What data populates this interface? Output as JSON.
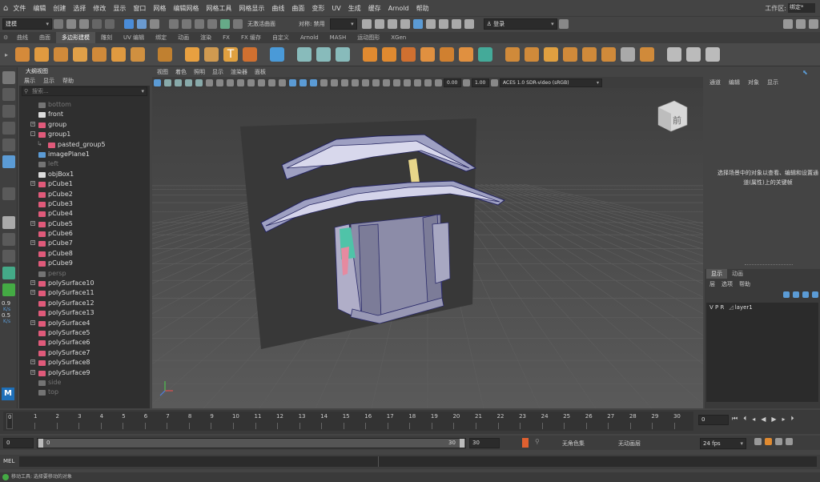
{
  "menubar": {
    "items": [
      "文件",
      "编辑",
      "创建",
      "选择",
      "修改",
      "显示",
      "窗口",
      "网格",
      "编辑网格",
      "网格工具",
      "网格显示",
      "曲线",
      "曲面",
      "变形",
      "UV",
      "生成",
      "缓存",
      "Arnold",
      "帮助"
    ],
    "workspace_label": "工作区:",
    "workspace_value": "绑定*"
  },
  "statusline": {
    "mode": "建模",
    "live_surface": "无激活曲面",
    "symmetry": "对称: 禁用",
    "login": "登录"
  },
  "shelf": {
    "tabs": [
      "曲线",
      "曲面",
      "多边形建模",
      "雕刻",
      "UV 编辑",
      "绑定",
      "动画",
      "渲染",
      "FX",
      "FX 缓存",
      "自定义",
      "Arnold",
      "MASH",
      "运动图形",
      "XGen"
    ],
    "active_tab": "多边形建模"
  },
  "outliner": {
    "title": "大纲视图",
    "menu": [
      "展示",
      "显示",
      "帮助"
    ],
    "search_placeholder": "搜索...",
    "items": [
      {
        "label": "bottom",
        "indent": 1,
        "expand": "",
        "icon": "camera-icon",
        "dim": true
      },
      {
        "label": "front",
        "indent": 1,
        "expand": "",
        "icon": "camera-icon",
        "dim": false
      },
      {
        "label": "group",
        "indent": 1,
        "expand": "+",
        "icon": "group-icon",
        "dim": false
      },
      {
        "label": "group1",
        "indent": 1,
        "expand": "-",
        "icon": "group-icon",
        "dim": false
      },
      {
        "label": "pasted_group5",
        "indent": 2,
        "expand": "",
        "icon": "group-icon",
        "dim": false
      },
      {
        "label": "imagePlane1",
        "indent": 1,
        "expand": "",
        "icon": "image-plane-icon",
        "dim": false
      },
      {
        "label": "left",
        "indent": 1,
        "expand": "",
        "icon": "camera-icon",
        "dim": true
      },
      {
        "label": "objBox1",
        "indent": 1,
        "expand": "",
        "icon": "object-icon",
        "dim": false
      },
      {
        "label": "pCube1",
        "indent": 1,
        "expand": "+",
        "icon": "mesh-icon",
        "dim": false
      },
      {
        "label": "pCube2",
        "indent": 1,
        "expand": "",
        "icon": "mesh-icon",
        "dim": false
      },
      {
        "label": "pCube3",
        "indent": 1,
        "expand": "",
        "icon": "mesh-icon",
        "dim": false
      },
      {
        "label": "pCube4",
        "indent": 1,
        "expand": "",
        "icon": "mesh-icon",
        "dim": false
      },
      {
        "label": "pCube5",
        "indent": 1,
        "expand": "+",
        "icon": "mesh-icon",
        "dim": false
      },
      {
        "label": "pCube6",
        "indent": 1,
        "expand": "",
        "icon": "mesh-icon",
        "dim": false
      },
      {
        "label": "pCube7",
        "indent": 1,
        "expand": "+",
        "icon": "mesh-icon",
        "dim": false
      },
      {
        "label": "pCube8",
        "indent": 1,
        "expand": "",
        "icon": "mesh-icon",
        "dim": false
      },
      {
        "label": "pCube9",
        "indent": 1,
        "expand": "",
        "icon": "mesh-icon",
        "dim": false
      },
      {
        "label": "persp",
        "indent": 1,
        "expand": "",
        "icon": "camera-icon",
        "dim": true
      },
      {
        "label": "polySurface10",
        "indent": 1,
        "expand": "+",
        "icon": "mesh-icon",
        "dim": false
      },
      {
        "label": "polySurface11",
        "indent": 1,
        "expand": "+",
        "icon": "mesh-icon",
        "dim": false
      },
      {
        "label": "polySurface12",
        "indent": 1,
        "expand": "",
        "icon": "mesh-icon",
        "dim": false
      },
      {
        "label": "polySurface13",
        "indent": 1,
        "expand": "",
        "icon": "mesh-icon",
        "dim": false
      },
      {
        "label": "polySurface4",
        "indent": 1,
        "expand": "+",
        "icon": "mesh-icon",
        "dim": false
      },
      {
        "label": "polySurface5",
        "indent": 1,
        "expand": "",
        "icon": "mesh-icon",
        "dim": false
      },
      {
        "label": "polySurface6",
        "indent": 1,
        "expand": "",
        "icon": "mesh-icon",
        "dim": false
      },
      {
        "label": "polySurface7",
        "indent": 1,
        "expand": "",
        "icon": "mesh-icon",
        "dim": false
      },
      {
        "label": "polySurface8",
        "indent": 1,
        "expand": "+",
        "icon": "mesh-icon",
        "dim": false
      },
      {
        "label": "polySurface9",
        "indent": 1,
        "expand": "+",
        "icon": "mesh-icon",
        "dim": false
      },
      {
        "label": "side",
        "indent": 1,
        "expand": "",
        "icon": "camera-icon",
        "dim": true
      },
      {
        "label": "top",
        "indent": 1,
        "expand": "",
        "icon": "camera-icon",
        "dim": true
      }
    ]
  },
  "viewport": {
    "menu": [
      "视图",
      "着色",
      "照明",
      "显示",
      "渲染器",
      "面板"
    ],
    "field_a": "0.00",
    "field_b": "1.00",
    "colorspace": "ACES 1.0 SDR-video (sRGB)",
    "viewcube_label": "前"
  },
  "toolbox": {
    "value_1": "0.9",
    "unit_1": "K/s",
    "value_2": "0.5",
    "unit_2": "K/s"
  },
  "channelbox": {
    "menu": [
      "通道",
      "编辑",
      "对象",
      "显示"
    ],
    "message": "选择场景中的对象以查看、编辑和设置通道(属性)上的关键帧"
  },
  "layereditor": {
    "tabs": [
      "显示",
      "动画"
    ],
    "menu": [
      "层",
      "选项",
      "帮助"
    ],
    "layer_flags": "V P R",
    "layer_name": "layer1"
  },
  "timeslider": {
    "ticks": [
      "1",
      "2",
      "3",
      "4",
      "5",
      "6",
      "7",
      "8",
      "9",
      "10",
      "11",
      "12",
      "13",
      "14",
      "15",
      "16",
      "17",
      "18",
      "19",
      "20",
      "21",
      "22",
      "23",
      "24",
      "25",
      "26",
      "27",
      "28",
      "29",
      "30"
    ],
    "current_frame": "0",
    "playhead": "0"
  },
  "rangeslider": {
    "start": "0",
    "inner_start": "0",
    "inner_end": "30",
    "end": "30",
    "character_set": "无角色集",
    "anim_layer": "无动画层",
    "fps": "24 fps"
  },
  "mel": {
    "label": "MEL"
  },
  "helpline": {
    "text": "移动工具: 选择要移动的对象"
  },
  "colors": {
    "ui_bg": "#444444",
    "panel_dark": "#2b2b2b",
    "viewport_bg": "#4d4d4d",
    "accent_blue": "#5b9bd5"
  }
}
